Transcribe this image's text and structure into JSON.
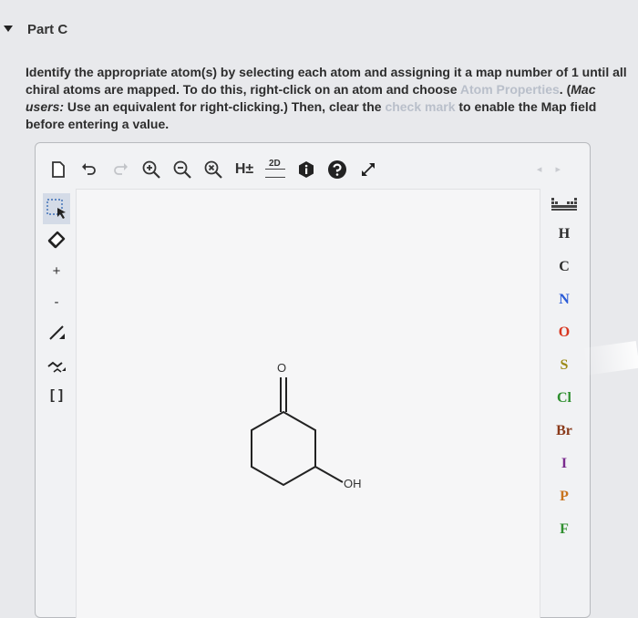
{
  "part": {
    "title": "Part C"
  },
  "instructions": {
    "p1": "Identify the appropriate atom(s) by selecting each atom and assigning it a map number of 1 until all chiral atoms are mapped. To do this, right-click on an atom and choose ",
    "atom_properties": "Atom Properties",
    "p2": ". (",
    "mac_users": "Mac users:",
    "p3": " Use an equivalent for right-clicking.) Then, clear the ",
    "check_mark": "check mark",
    "p4": " to enable the Map field before entering a value."
  },
  "toolbar": {
    "h_toggle": "H±",
    "two_d": "2D",
    "nav": "◂ ▸"
  },
  "left_tools": {
    "plus": "+",
    "minus": "-",
    "bracket": "[ ]"
  },
  "elements": [
    "H",
    "C",
    "N",
    "O",
    "S",
    "Cl",
    "Br",
    "I",
    "P",
    "F"
  ],
  "molecule": {
    "carbonyl_label": "O",
    "hydroxyl_label": "OH"
  },
  "colors": {
    "accent_selected": "#d4dbe7",
    "faded_link": "#b9bfca",
    "oxygen": "#d8361f",
    "nitrogen": "#2a5bd7"
  }
}
